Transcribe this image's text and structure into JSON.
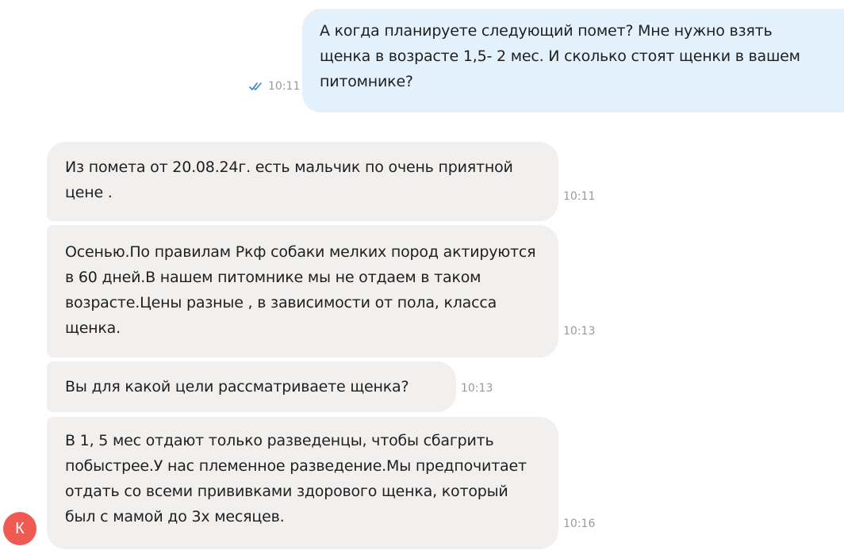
{
  "messages": {
    "outgoing": {
      "text": "А когда планируете следующий помет? Мне нужно взять щенка в возрасте 1,5- 2 мес. И сколько стоят щенки в вашем питомнике?",
      "time": "10:11",
      "status": "read"
    },
    "incoming": [
      {
        "text": "Из помета от 20.08.24г. есть мальчик по очень приятной цене .",
        "time": "10:11"
      },
      {
        "text": "Осенью.По правилам Ркф собаки мелких пород актируются в 60 дней.В нашем питомнике мы не отдаем в таком возрасте.Цены разные , в зависимости от пола, класса щенка.",
        "time": "10:13"
      },
      {
        "text": "Вы для какой цели рассматриваете щенка?",
        "time": "10:13"
      },
      {
        "text": "В 1, 5 мес отдают только разведенцы, чтобы сбагрить побыстрее.У нас племенное разведение.Мы предпочитает отдать со всеми прививками здорового щенка, который был с мамой до 3х месяцев.",
        "time": "10:16"
      }
    ]
  },
  "sender": {
    "initial": "К",
    "avatar_color": "#ef5a52"
  },
  "colors": {
    "outgoing_bubble": "#e2f1fb",
    "incoming_bubble": "#f1f0ef",
    "read_checks": "#3b82c4",
    "timestamp": "#9a9a9a"
  },
  "icons": {
    "status": "double-check-icon"
  }
}
